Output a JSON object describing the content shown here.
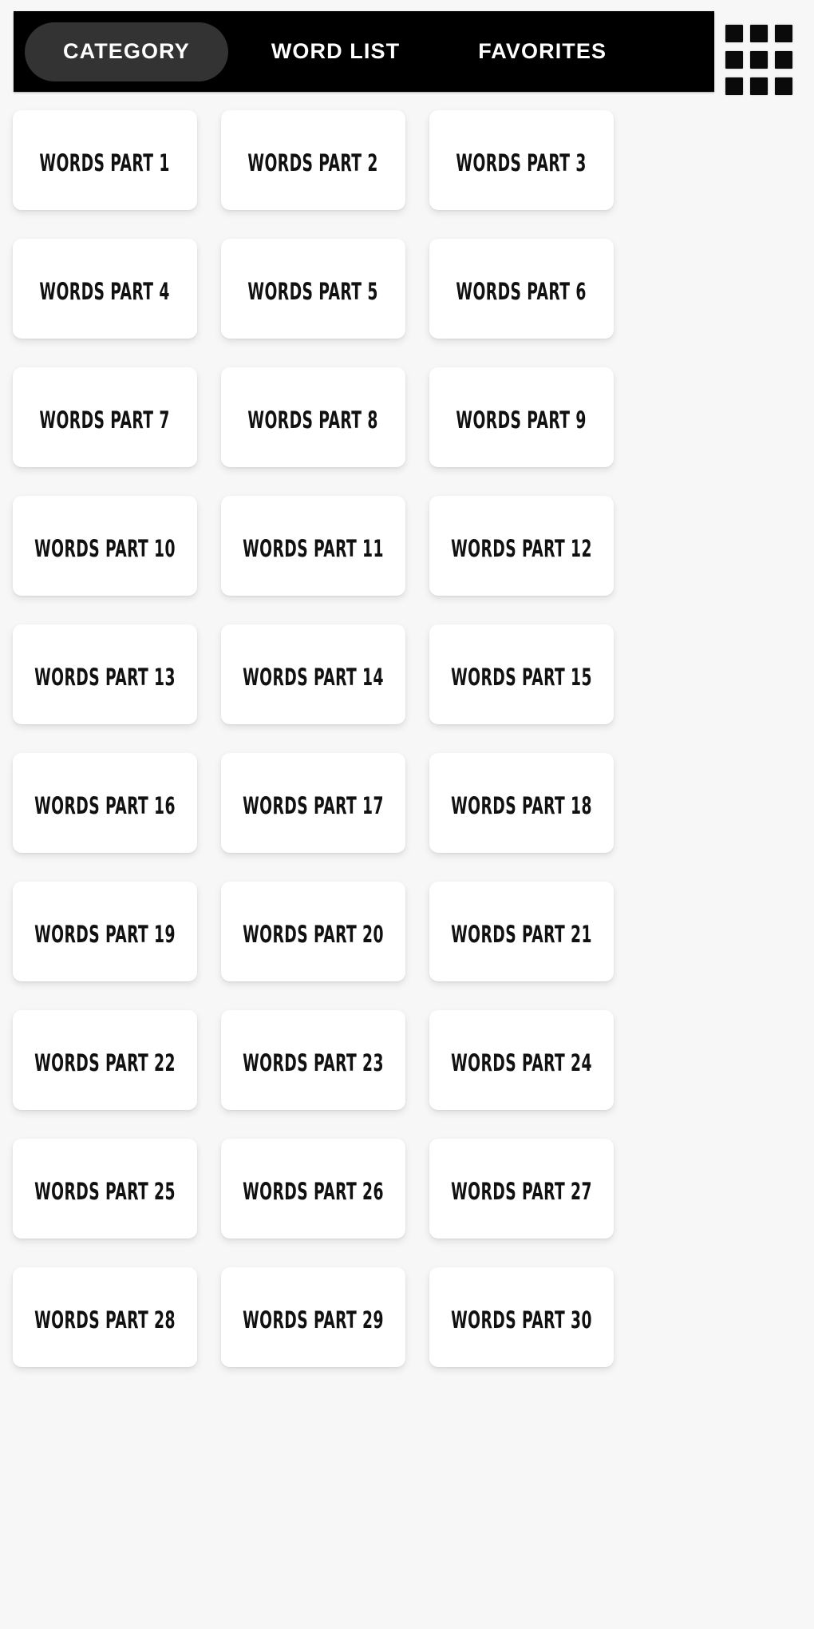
{
  "topbar": {
    "tabs": [
      {
        "label": "CATEGORY",
        "active": true
      },
      {
        "label": "WORD LIST",
        "active": false
      },
      {
        "label": "FAVORITES",
        "active": false
      }
    ],
    "grid_icon": "grid-menu-icon",
    "bar_color": "#000000",
    "active_tab_color": "#333333",
    "text_color": "#ffffff"
  },
  "page": {
    "background_color": "#f7f7f7",
    "card_color": "#ffffff",
    "card_text_color": "#111111"
  },
  "cards": [
    {
      "label": "WORDS PART 1"
    },
    {
      "label": "WORDS PART 2"
    },
    {
      "label": "WORDS PART 3"
    },
    {
      "label": "WORDS PART 4"
    },
    {
      "label": "WORDS PART 5"
    },
    {
      "label": "WORDS PART 6"
    },
    {
      "label": "WORDS PART 7"
    },
    {
      "label": "WORDS PART 8"
    },
    {
      "label": "WORDS PART 9"
    },
    {
      "label": "WORDS PART 10"
    },
    {
      "label": "WORDS PART 11"
    },
    {
      "label": "WORDS PART 12"
    },
    {
      "label": "WORDS PART 13"
    },
    {
      "label": "WORDS PART 14"
    },
    {
      "label": "WORDS PART 15"
    },
    {
      "label": "WORDS PART 16"
    },
    {
      "label": "WORDS PART 17"
    },
    {
      "label": "WORDS PART 18"
    },
    {
      "label": "WORDS PART 19"
    },
    {
      "label": "WORDS PART 20"
    },
    {
      "label": "WORDS PART 21"
    },
    {
      "label": "WORDS PART 22"
    },
    {
      "label": "WORDS PART 23"
    },
    {
      "label": "WORDS PART 24"
    },
    {
      "label": "WORDS PART 25"
    },
    {
      "label": "WORDS PART 26"
    },
    {
      "label": "WORDS PART 27"
    },
    {
      "label": "WORDS PART 28"
    },
    {
      "label": "WORDS PART 29"
    },
    {
      "label": "WORDS PART 30"
    }
  ]
}
